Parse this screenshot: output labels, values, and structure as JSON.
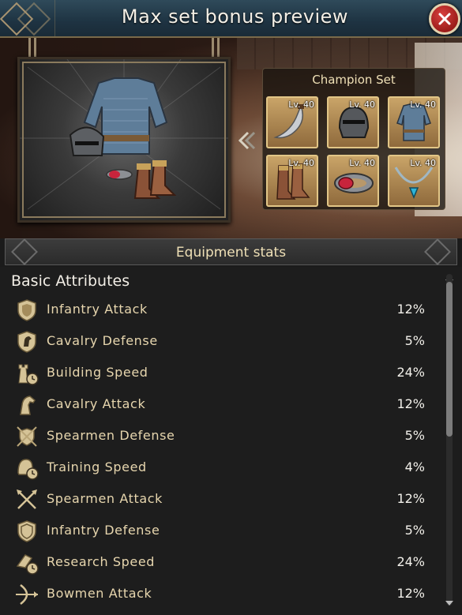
{
  "header": {
    "title": "Max set bonus preview"
  },
  "set_panel": {
    "title": "Champion Set",
    "slots": [
      {
        "level": "Lv. 40",
        "icon": "scimitar-icon"
      },
      {
        "level": "Lv. 40",
        "icon": "helmet-icon"
      },
      {
        "level": "Lv. 40",
        "icon": "chainmail-armor-icon"
      },
      {
        "level": "Lv. 40",
        "icon": "boots-icon"
      },
      {
        "level": "Lv. 40",
        "icon": "ruby-belt-icon"
      },
      {
        "level": "Lv. 40",
        "icon": "sapphire-necklace-icon"
      }
    ]
  },
  "stats": {
    "header_title": "Equipment stats",
    "section_title": "Basic Attributes",
    "rows": [
      {
        "name": "Infantry Attack",
        "value": "12%",
        "icon": "shield-icon"
      },
      {
        "name": "Cavalry Defense",
        "value": "5%",
        "icon": "horse-shield-icon"
      },
      {
        "name": "Building Speed",
        "value": "24%",
        "icon": "tower-clock-icon"
      },
      {
        "name": "Cavalry Attack",
        "value": "12%",
        "icon": "horse-head-icon"
      },
      {
        "name": "Spearmen Defense",
        "value": "5%",
        "icon": "crossed-spears-shield-icon"
      },
      {
        "name": "Training Speed",
        "value": "4%",
        "icon": "helmet-clock-icon"
      },
      {
        "name": "Spearmen Attack",
        "value": "12%",
        "icon": "crossed-spears-icon"
      },
      {
        "name": "Infantry Defense",
        "value": "5%",
        "icon": "shield-outline-icon"
      },
      {
        "name": "Research Speed",
        "value": "24%",
        "icon": "research-clock-icon"
      },
      {
        "name": "Bowmen Attack",
        "value": "12%",
        "icon": "bow-arrow-icon"
      }
    ]
  },
  "colors": {
    "header_bg": "#1e3342",
    "accent_gold": "#e2c687",
    "stat_name": "#e7d6ae",
    "close_red": "#c0302d"
  }
}
